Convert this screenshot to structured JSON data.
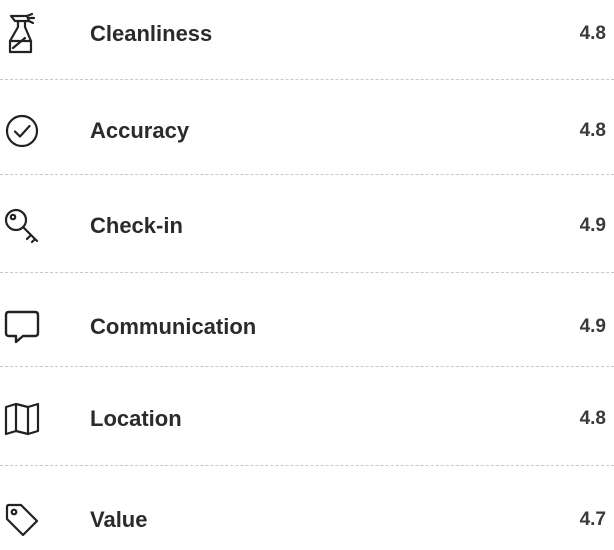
{
  "ratings": [
    {
      "icon": "spray-bottle-icon",
      "label": "Cleanliness",
      "score": "4.8"
    },
    {
      "icon": "check-circle-icon",
      "label": "Accuracy",
      "score": "4.8"
    },
    {
      "icon": "key-icon",
      "label": "Check-in",
      "score": "4.9"
    },
    {
      "icon": "chat-bubble-icon",
      "label": "Communication",
      "score": "4.9"
    },
    {
      "icon": "map-icon",
      "label": "Location",
      "score": "4.8"
    },
    {
      "icon": "tag-icon",
      "label": "Value",
      "score": "4.7"
    }
  ],
  "colors": {
    "text": "#2b2b2b",
    "icon_stroke": "#222222",
    "divider": "#c9c9c9",
    "background": "#ffffff"
  }
}
